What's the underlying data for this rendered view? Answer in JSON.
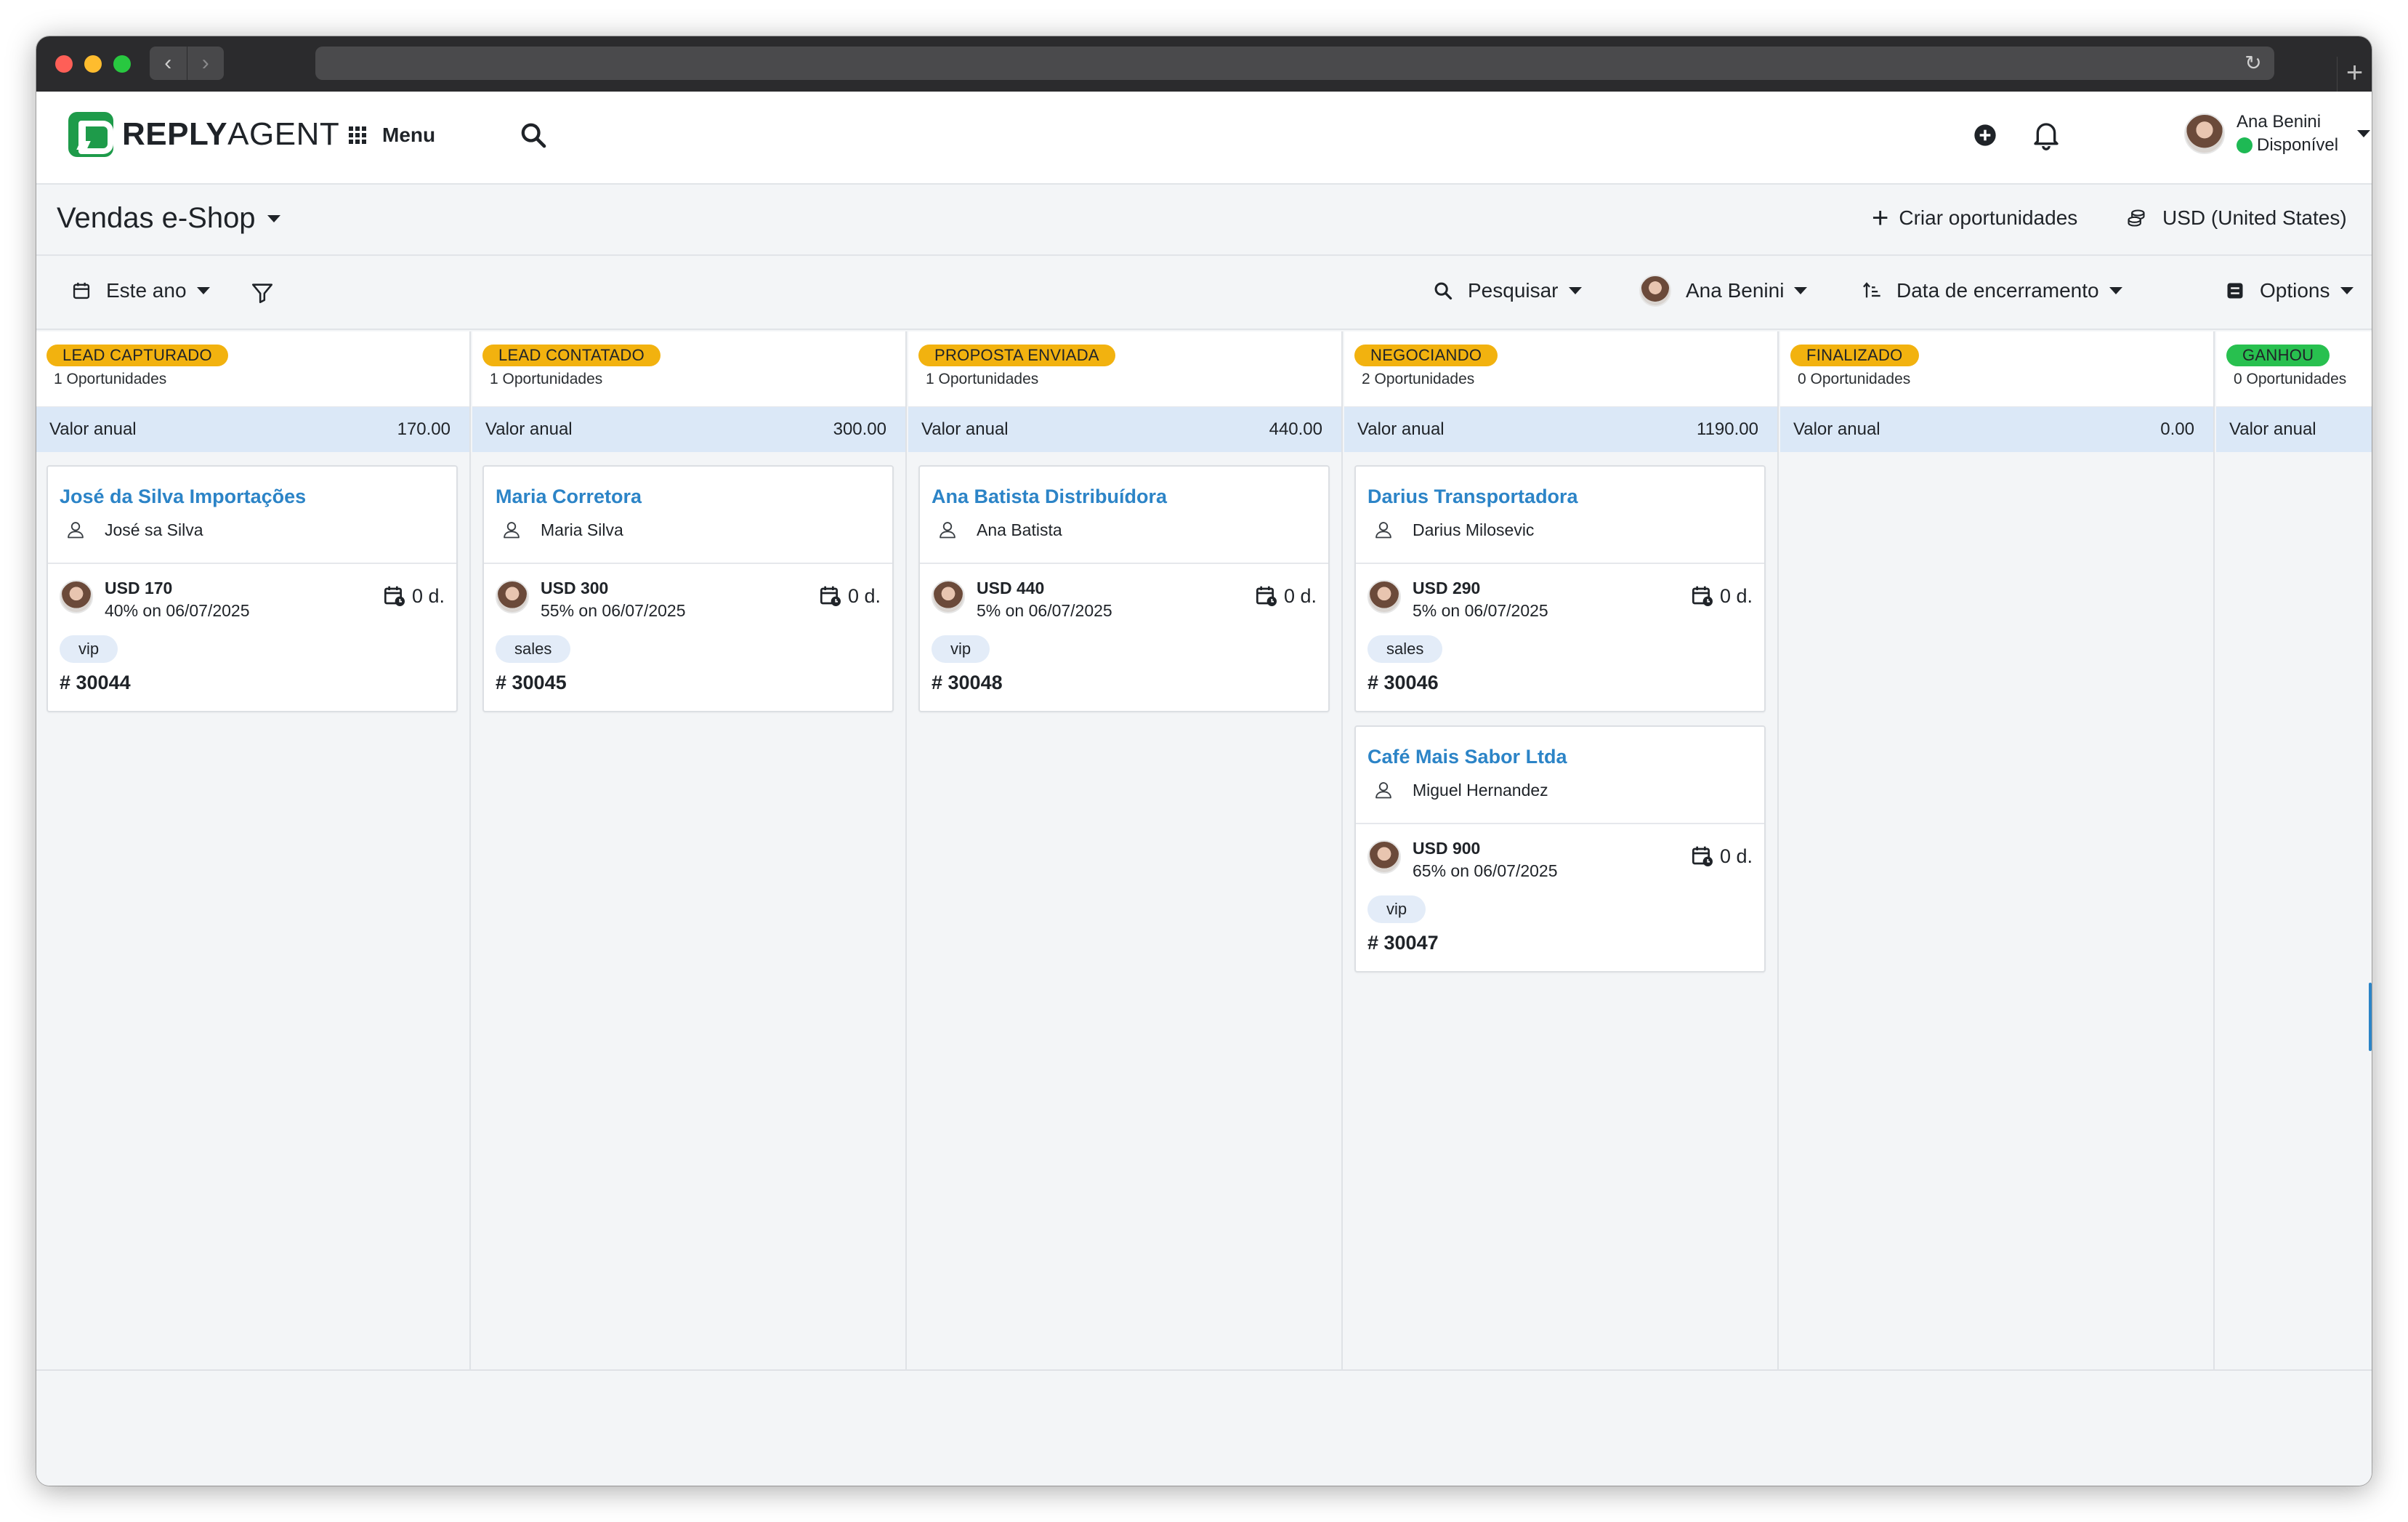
{
  "app": {
    "brand_bold": "REPLY",
    "brand_light": "AGENT",
    "menu_label": "Menu",
    "user_name": "Ana Benini",
    "user_status": "Disponível",
    "status_color": "#1eb954",
    "accent_color": "#2c84c7",
    "stage_color": "#f2b20f",
    "won_color": "#28c04f"
  },
  "pipeline": {
    "title": "Vendas e-Shop",
    "create_label": "Criar oportunidades",
    "currency_label": "USD (United States)"
  },
  "filters": {
    "period": "Este ano",
    "search": "Pesquisar",
    "owner": "Ana Benini",
    "sort": "Data de encerramento",
    "options": "Options"
  },
  "value_label": "Valor anual",
  "columns": [
    {
      "stage": "LEAD CAPTURADO",
      "count": "1 Oportunidades",
      "value": "170.00",
      "cards": [
        {
          "title": "José da Silva Importações",
          "contact": "José sa Silva",
          "amount": "USD 170",
          "probability": "40% on 06/07/2025",
          "due": "0 d.",
          "tag": "vip",
          "id": "# 30044"
        }
      ]
    },
    {
      "stage": "LEAD CONTATADO",
      "count": "1 Oportunidades",
      "value": "300.00",
      "cards": [
        {
          "title": "Maria Corretora",
          "contact": "Maria Silva",
          "amount": "USD 300",
          "probability": "55% on 06/07/2025",
          "due": "0 d.",
          "tag": "sales",
          "id": "# 30045"
        }
      ]
    },
    {
      "stage": "PROPOSTA ENVIADA",
      "count": "1 Oportunidades",
      "value": "440.00",
      "cards": [
        {
          "title": "Ana Batista Distribuídora",
          "contact": "Ana Batista",
          "amount": "USD 440",
          "probability": "5% on 06/07/2025",
          "due": "0 d.",
          "tag": "vip",
          "id": "# 30048"
        }
      ]
    },
    {
      "stage": "NEGOCIANDO",
      "count": "2 Oportunidades",
      "value": "1190.00",
      "cards": [
        {
          "title": "Darius Transportadora",
          "contact": "Darius Milosevic",
          "amount": "USD 290",
          "probability": "5% on 06/07/2025",
          "due": "0 d.",
          "tag": "sales",
          "id": "# 30046"
        },
        {
          "title": "Café Mais Sabor Ltda",
          "contact": "Miguel Hernandez",
          "amount": "USD 900",
          "probability": "65% on 06/07/2025",
          "due": "0 d.",
          "tag": "vip",
          "id": "# 30047"
        }
      ]
    },
    {
      "stage": "FINALIZADO",
      "count": "0 Oportunidades",
      "value": "0.00",
      "cards": []
    },
    {
      "stage": "GANHOU",
      "count": "0 Oportunidades",
      "value": "",
      "cards": []
    }
  ]
}
